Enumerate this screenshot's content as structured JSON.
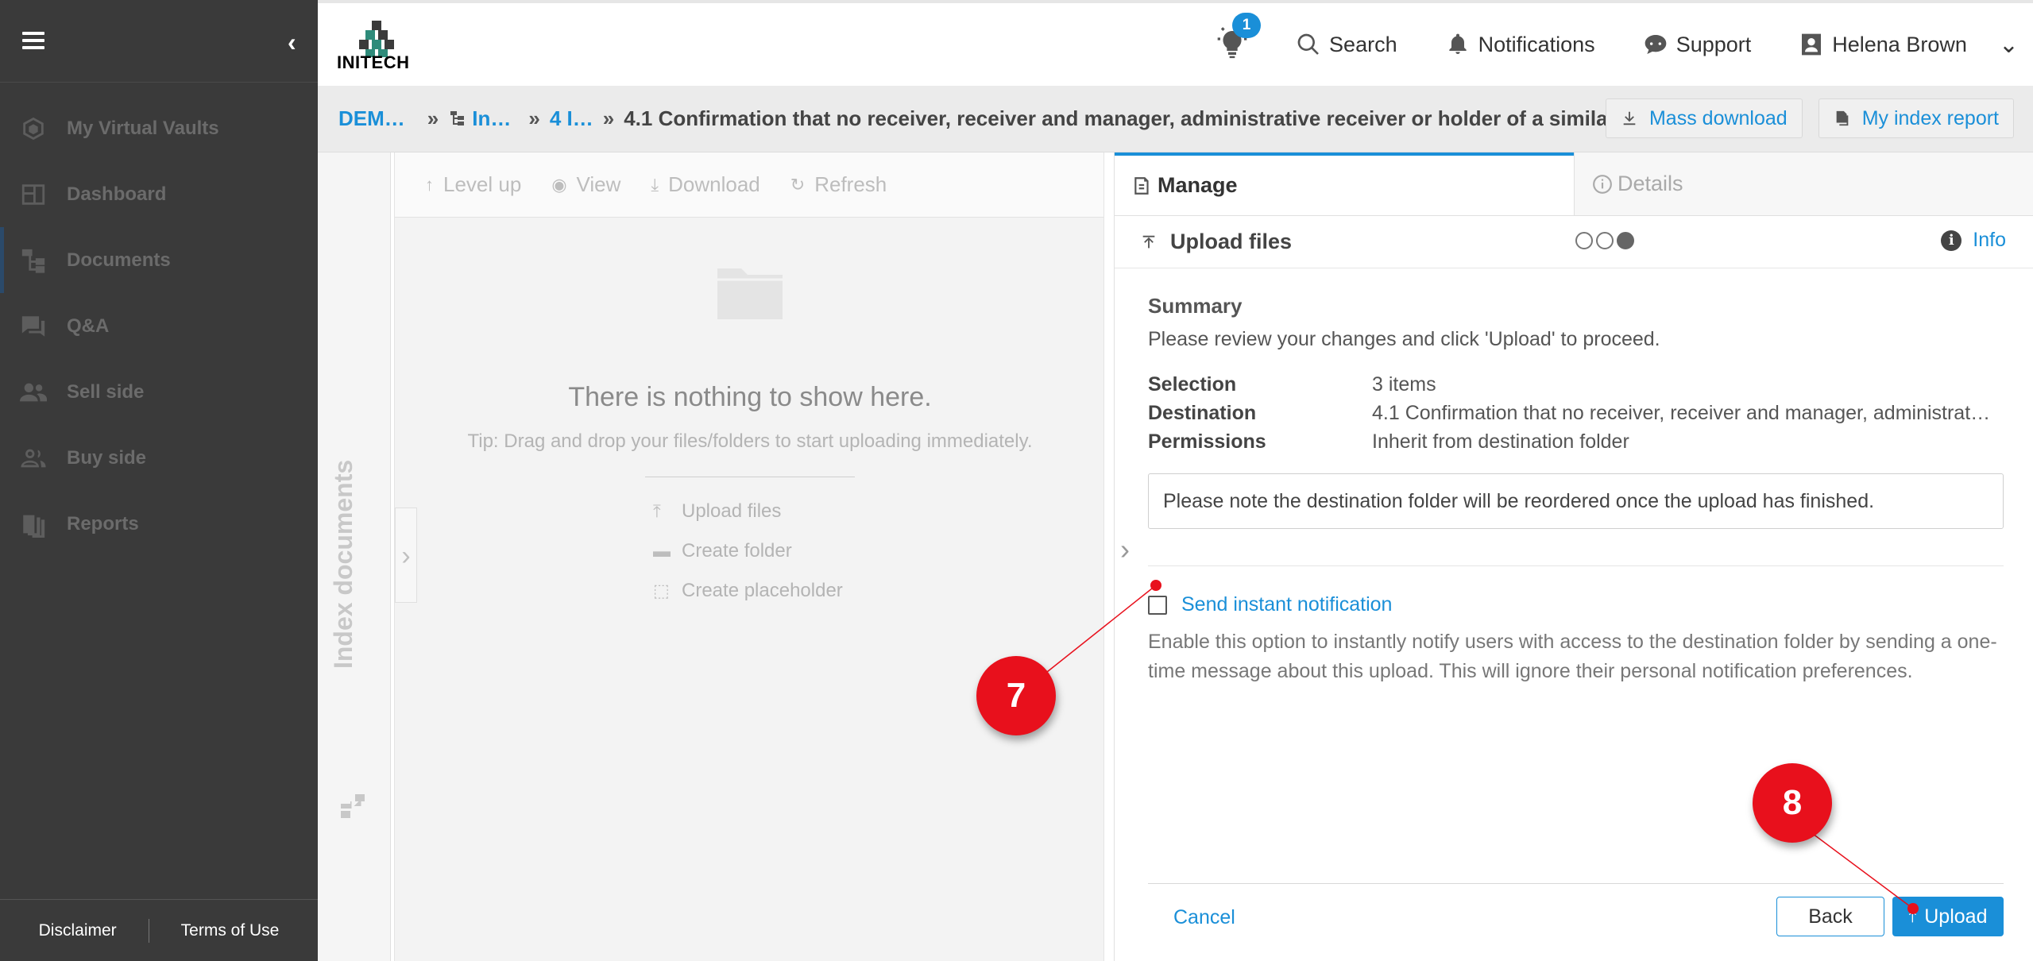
{
  "sidebar": {
    "items": [
      {
        "label": "My Virtual Vaults",
        "icon": "vault-icon"
      },
      {
        "label": "Dashboard",
        "icon": "dashboard-icon"
      },
      {
        "label": "Documents",
        "icon": "documents-tree-icon"
      },
      {
        "label": "Q&A",
        "icon": "qa-icon"
      },
      {
        "label": "Sell side",
        "icon": "sell-side-icon"
      },
      {
        "label": "Buy side",
        "icon": "buy-side-icon"
      },
      {
        "label": "Reports",
        "icon": "reports-icon"
      }
    ],
    "active_item": "Documents",
    "footer": {
      "disclaimer": "Disclaimer",
      "terms": "Terms of Use"
    }
  },
  "header": {
    "logo_text": "INITECH",
    "bulb_badge": "1",
    "search_label": "Search",
    "notifications_label": "Notifications",
    "support_label": "Support",
    "user_name": "Helena Brown"
  },
  "breadcrumb": {
    "items": [
      "DEM…",
      "In…",
      "4 I…"
    ],
    "current": "4.1 Confirmation that no receiver, receiver and manager, administrative receiver or holder of a simila…",
    "separator": "»",
    "mass_download": "Mass download",
    "index_report": "My index report"
  },
  "index_strip": {
    "label": "Index documents"
  },
  "filepane": {
    "toolbar": {
      "level_up": "Level up",
      "view": "View",
      "download": "Download",
      "refresh": "Refresh"
    },
    "empty_title": "There is nothing to show here.",
    "empty_tip": "Tip: Drag and drop your files/folders to start uploading immediately.",
    "actions": {
      "upload_files": "Upload files",
      "create_folder": "Create folder",
      "create_placeholder": "Create placeholder"
    }
  },
  "panel": {
    "tabs": {
      "manage": "Manage",
      "details": "Details"
    },
    "header_title": "Upload files",
    "info_label": "Info",
    "steps": {
      "total": 3,
      "current": 3
    },
    "summary_title": "Summary",
    "summary_desc": "Please review your changes and click 'Upload' to proceed.",
    "rows": [
      {
        "key": "Selection",
        "value": "3 items"
      },
      {
        "key": "Destination",
        "value": "4.1 Confirmation that no receiver, receiver and manager, administrat…"
      },
      {
        "key": "Permissions",
        "value": "Inherit from destination folder"
      }
    ],
    "note": "Please note the destination folder will be reordered once the upload has finished.",
    "notify_label": "Send instant notification",
    "notify_checked": false,
    "notify_desc": "Enable this option to instantly notify users with access to the destination folder by sending a one-time message about this upload. This will ignore their personal notification preferences.",
    "cancel": "Cancel",
    "back": "Back",
    "upload": "Upload"
  },
  "callouts": {
    "first": "7",
    "second": "8"
  },
  "colors": {
    "accent": "#1a8fd8",
    "sidebar_bg": "#3a3a3a",
    "callout": "#e8101c"
  }
}
